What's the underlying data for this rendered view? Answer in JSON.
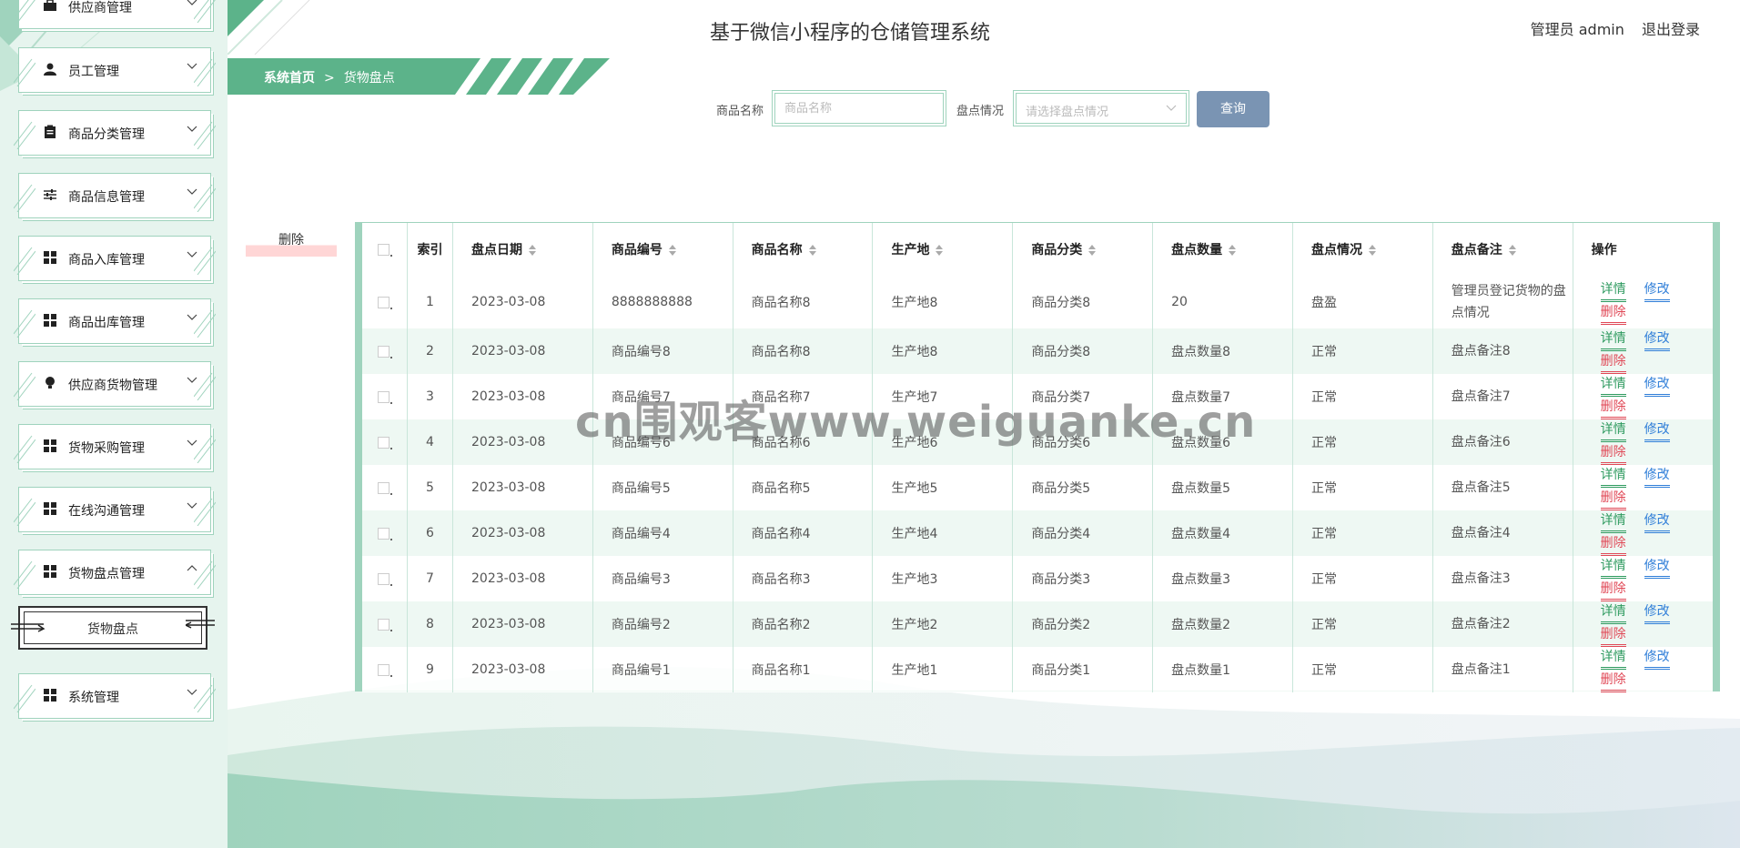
{
  "app_title": "基于微信小程序的仓储管理系统",
  "user": {
    "label": "管理员 admin",
    "logout": "退出登录"
  },
  "breadcrumb": {
    "home": "系统首页",
    "sep": ">",
    "current": "货物盘点"
  },
  "sidebar": {
    "items": [
      {
        "label": "供应商管理",
        "icon": "briefcase-icon"
      },
      {
        "label": "员工管理",
        "icon": "user-icon"
      },
      {
        "label": "商品分类管理",
        "icon": "clipboard-icon"
      },
      {
        "label": "商品信息管理",
        "icon": "sliders-icon"
      },
      {
        "label": "商品入库管理",
        "icon": "grid-icon"
      },
      {
        "label": "商品出库管理",
        "icon": "grid-icon"
      },
      {
        "label": "供应商货物管理",
        "icon": "bulb-icon"
      },
      {
        "label": "货物采购管理",
        "icon": "grid-icon"
      },
      {
        "label": "在线沟通管理",
        "icon": "grid-icon"
      },
      {
        "label": "货物盘点管理",
        "icon": "grid-icon",
        "expanded": true
      },
      {
        "label": "系统管理",
        "icon": "grid-icon"
      }
    ],
    "submenu": {
      "label": "货物盘点"
    }
  },
  "search": {
    "name_label": "商品名称",
    "name_placeholder": "商品名称",
    "status_label": "盘点情况",
    "status_placeholder": "请选择盘点情况",
    "query_button": "查询"
  },
  "delete_button": "删除",
  "table": {
    "headers": {
      "index": "索引",
      "date": "盘点日期",
      "code": "商品编号",
      "name": "商品名称",
      "origin": "生产地",
      "category": "商品分类",
      "qty": "盘点数量",
      "status": "盘点情况",
      "note": "盘点备注",
      "op": "操作"
    },
    "actions": {
      "detail": "详情",
      "edit": "修改",
      "delete": "删除"
    },
    "rows": [
      {
        "idx": "1",
        "date": "2023-03-08",
        "code": "8888888888",
        "name": "商品名称8",
        "origin": "生产地8",
        "category": "商品分类8",
        "qty": "20",
        "status": "盘盈",
        "note": "管理员登记货物的盘点情况"
      },
      {
        "idx": "2",
        "date": "2023-03-08",
        "code": "商品编号8",
        "name": "商品名称8",
        "origin": "生产地8",
        "category": "商品分类8",
        "qty": "盘点数量8",
        "status": "正常",
        "note": "盘点备注8"
      },
      {
        "idx": "3",
        "date": "2023-03-08",
        "code": "商品编号7",
        "name": "商品名称7",
        "origin": "生产地7",
        "category": "商品分类7",
        "qty": "盘点数量7",
        "status": "正常",
        "note": "盘点备注7"
      },
      {
        "idx": "4",
        "date": "2023-03-08",
        "code": "商品编号6",
        "name": "商品名称6",
        "origin": "生产地6",
        "category": "商品分类6",
        "qty": "盘点数量6",
        "status": "正常",
        "note": "盘点备注6"
      },
      {
        "idx": "5",
        "date": "2023-03-08",
        "code": "商品编号5",
        "name": "商品名称5",
        "origin": "生产地5",
        "category": "商品分类5",
        "qty": "盘点数量5",
        "status": "正常",
        "note": "盘点备注5"
      },
      {
        "idx": "6",
        "date": "2023-03-08",
        "code": "商品编号4",
        "name": "商品名称4",
        "origin": "生产地4",
        "category": "商品分类4",
        "qty": "盘点数量4",
        "status": "正常",
        "note": "盘点备注4"
      },
      {
        "idx": "7",
        "date": "2023-03-08",
        "code": "商品编号3",
        "name": "商品名称3",
        "origin": "生产地3",
        "category": "商品分类3",
        "qty": "盘点数量3",
        "status": "正常",
        "note": "盘点备注3"
      },
      {
        "idx": "8",
        "date": "2023-03-08",
        "code": "商品编号2",
        "name": "商品名称2",
        "origin": "生产地2",
        "category": "商品分类2",
        "qty": "盘点数量2",
        "status": "正常",
        "note": "盘点备注2"
      },
      {
        "idx": "9",
        "date": "2023-03-08",
        "code": "商品编号1",
        "name": "商品名称1",
        "origin": "生产地1",
        "category": "商品分类1",
        "qty": "盘点数量1",
        "status": "正常",
        "note": "盘点备注1"
      }
    ]
  },
  "watermark": "cn围观客www.weiguanke.cn",
  "colors": {
    "accent": "#5cb38a",
    "sidebar_bg": "#e6f4ee",
    "query_btn": "#7a94b3",
    "detail": "#2e9a5f",
    "edit": "#2f7ed8",
    "delete": "#e04755"
  }
}
